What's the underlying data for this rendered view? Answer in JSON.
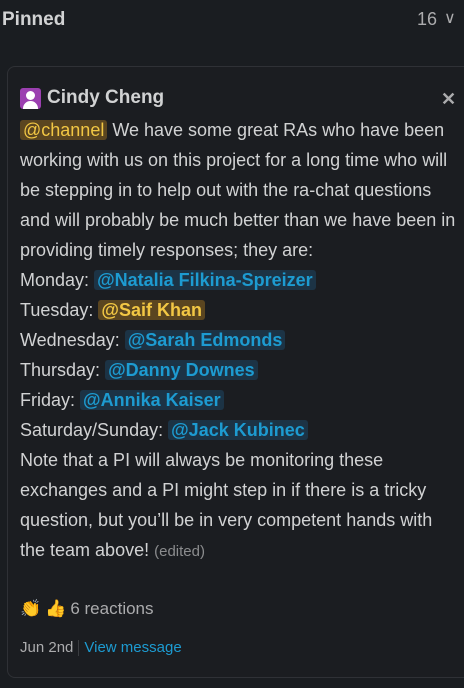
{
  "header": {
    "title": "Pinned",
    "count": "16"
  },
  "message": {
    "author": "Cindy Cheng",
    "channel_mention": "@channel",
    "intro": " We  have some great RAs who have been working with us on this project for a long time who will be stepping in to help out with the ra-chat questions and will probably be much better than we have been in providing timely responses; they are:",
    "schedule": [
      {
        "day": "Monday:",
        "mention": "@Natalia Filkina-Spreizer",
        "self": false
      },
      {
        "day": "Tuesday:",
        "mention": "@Saif Khan",
        "self": true
      },
      {
        "day": "Wednesday:",
        "mention": "@Sarah Edmonds",
        "self": false
      },
      {
        "day": "Thursday:",
        "mention": "@Danny Downes",
        "self": false
      },
      {
        "day": "Friday:",
        "mention": "@Annika Kaiser",
        "self": false
      },
      {
        "day": "Saturday/Sunday:",
        "mention": "@Jack Kubinec",
        "self": false
      }
    ],
    "outro": " Note that a PI will always be monitoring these exchanges and a PI might step in if there is a tricky question, but you’ll be in very competent hands with the team above!",
    "edited": "(edited)",
    "reactions": {
      "emojis": [
        "👏",
        "👍"
      ],
      "label": "6 reactions"
    },
    "date": "Jun 2nd",
    "view_link": "View message"
  }
}
